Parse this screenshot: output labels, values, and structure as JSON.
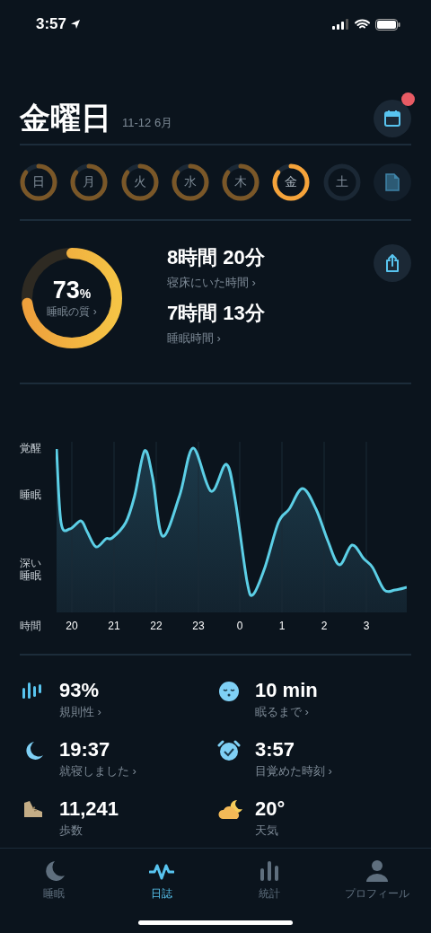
{
  "status_bar": {
    "time": "3:57"
  },
  "header": {
    "title": "金曜日",
    "date_range": "11-12 6月",
    "calendar_badge": true
  },
  "days": [
    {
      "label": "日",
      "recorded": true,
      "selected": false
    },
    {
      "label": "月",
      "recorded": true,
      "selected": false
    },
    {
      "label": "火",
      "recorded": true,
      "selected": false
    },
    {
      "label": "水",
      "recorded": true,
      "selected": false
    },
    {
      "label": "木",
      "recorded": true,
      "selected": false
    },
    {
      "label": "金",
      "recorded": true,
      "selected": true
    },
    {
      "label": "土",
      "recorded": false,
      "selected": false
    }
  ],
  "summary": {
    "quality": {
      "value": "73",
      "unit": "%",
      "label": "睡眠の質 ›",
      "level": 0.73
    },
    "metrics": [
      {
        "value": "8時間 20分",
        "label": "寝床にいた時間 ›"
      },
      {
        "value": "7時間 13分",
        "label": "睡眠時間 ›"
      }
    ]
  },
  "sleep_graph": {
    "y_labels": [
      "覚醒",
      "睡眠",
      "深い睡眠"
    ],
    "axis_title": "時間",
    "x_labels": [
      "20",
      "21",
      "22",
      "23",
      "0",
      "1",
      "2",
      "3"
    ]
  },
  "stats": [
    {
      "kind": "regularity",
      "value": "93%",
      "label": "規則性 ›"
    },
    {
      "kind": "fall-asleep",
      "value": "10 min",
      "label": "眠るまで ›"
    },
    {
      "kind": "bedtime",
      "value": "19:37",
      "label": "就寝しました ›"
    },
    {
      "kind": "wake",
      "value": "3:57",
      "label": "目覚めた時刻 ›"
    },
    {
      "kind": "steps",
      "value": "11,241",
      "label": "歩数"
    },
    {
      "kind": "weather",
      "value": "20°",
      "label": "天気"
    }
  ],
  "tabs": [
    {
      "kind": "sleep",
      "label": "睡眠",
      "selected": false
    },
    {
      "kind": "journal",
      "label": "日誌",
      "selected": true
    },
    {
      "kind": "stats",
      "label": "統計",
      "selected": false
    },
    {
      "kind": "profile",
      "label": "プロフィール",
      "selected": false
    }
  ]
}
